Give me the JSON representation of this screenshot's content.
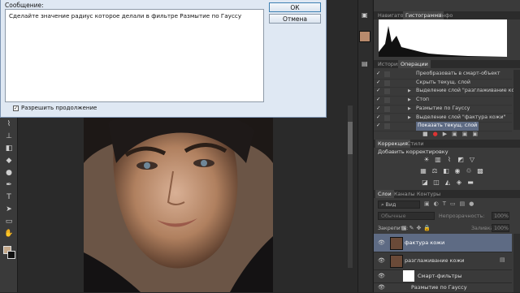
{
  "dialog": {
    "label": "Сообщение:",
    "message": "Сделайте значение радиус которое делали в фильтре Размытие по Гауссу",
    "ok": "ОК",
    "cancel": "Отмена",
    "continue_label": "Разрешить продолжение"
  },
  "toolbar": {
    "tools": [
      "brush-icon",
      "stamp-icon",
      "eraser-icon",
      "paint-bucket-icon",
      "blur-icon",
      "dodge-icon",
      "pen-icon",
      "type-icon",
      "path-selection-icon",
      "shape-icon",
      "hand-icon",
      "zoom-icon"
    ],
    "colors": {
      "foreground": "#c4a88a",
      "background": "#111111"
    }
  },
  "navigator_tabs": [
    "Навигатор",
    "Гистограмма",
    "Инфо"
  ],
  "actions_tabs": [
    "История",
    "Операции"
  ],
  "actions": [
    {
      "text": "Преобразовать в смарт-объект",
      "checked": true,
      "expandable": false,
      "selected": false
    },
    {
      "text": "Скрыть текущ. слой",
      "checked": true,
      "expandable": false,
      "selected": false
    },
    {
      "text": "Выделение слой \"разглаживание кожи\"",
      "checked": true,
      "expandable": true,
      "selected": false
    },
    {
      "text": "Стоп",
      "checked": true,
      "expandable": true,
      "selected": false
    },
    {
      "text": "Размытие по Гауссу",
      "checked": true,
      "expandable": true,
      "selected": false
    },
    {
      "text": "Выделение слой \"фактура кожи\"",
      "checked": true,
      "expandable": true,
      "selected": false
    },
    {
      "text": "Показать текущ. слой",
      "checked": true,
      "expandable": false,
      "selected": true
    }
  ],
  "adjust_tabs": [
    "Коррекция",
    "Стили"
  ],
  "adjust_title": "Добавить корректировку",
  "layers_tabs": [
    "Слои",
    "Каналы",
    "Контуры"
  ],
  "layers_filter": "Вид",
  "blend_mode": "Обычные",
  "opacity_label": "Непрозрачность:",
  "opacity_value": "100%",
  "lock_label": "Закрепить:",
  "fill_label": "Заливка:",
  "fill_value": "100%",
  "layers": [
    {
      "name": "фактура кожи",
      "selected": true
    },
    {
      "name": "разглаживание кожи",
      "selected": false
    },
    {
      "name": "Смарт-фильтры",
      "selected": false
    },
    {
      "name": "Размытие по Гауссу",
      "selected": false
    }
  ],
  "accent": "#5e6b84"
}
